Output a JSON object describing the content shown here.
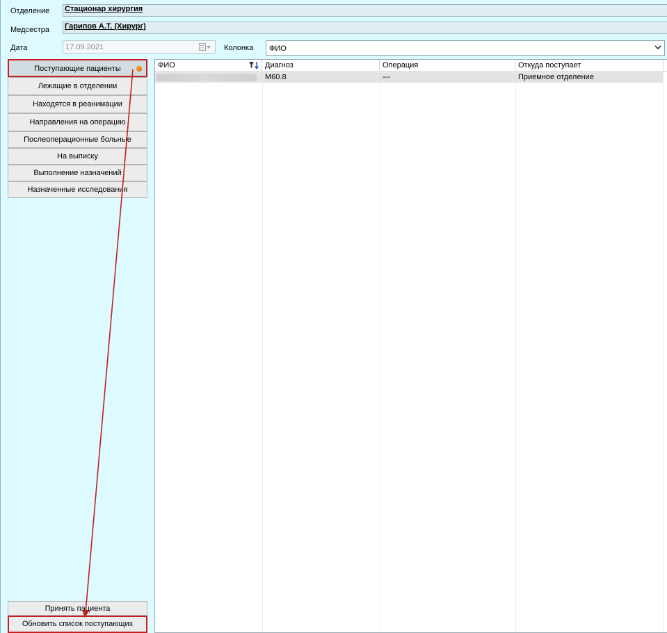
{
  "form": {
    "department_label": "Отделение",
    "department_value": "Стационар  хирургия",
    "nurse_label": "Медсестра",
    "nurse_value": "Гарипов А.Т. (Хирург)",
    "date_label": "Дата",
    "date_value": "17.09.2021",
    "column_label": "Колонка",
    "column_value": "ФИО"
  },
  "nav": {
    "items": [
      "Поступающие пациенты",
      "Лежащие в отделении",
      "Находятся в реанимации",
      "Направления на операцию",
      "Послеоперационные больные",
      "На выписку",
      "Выполнение назначений",
      "Назначенные исследования"
    ]
  },
  "actions": {
    "accept": "Принять пациента",
    "refresh": "Обновить список поступающих"
  },
  "grid": {
    "columns": [
      "ФИО",
      "Диагноз",
      "Операция",
      "Откуда поступает"
    ],
    "rows": [
      {
        "fio": "",
        "diagnosis": "M60.8",
        "operation": "---",
        "source": "Приемное отделение"
      }
    ]
  },
  "colors": {
    "background": "#dcfaff",
    "highlight": "#c42020"
  },
  "icons": [
    "calendar-icon",
    "chevron-down-icon",
    "filter-sort-icon",
    "status-dot-icon"
  ]
}
